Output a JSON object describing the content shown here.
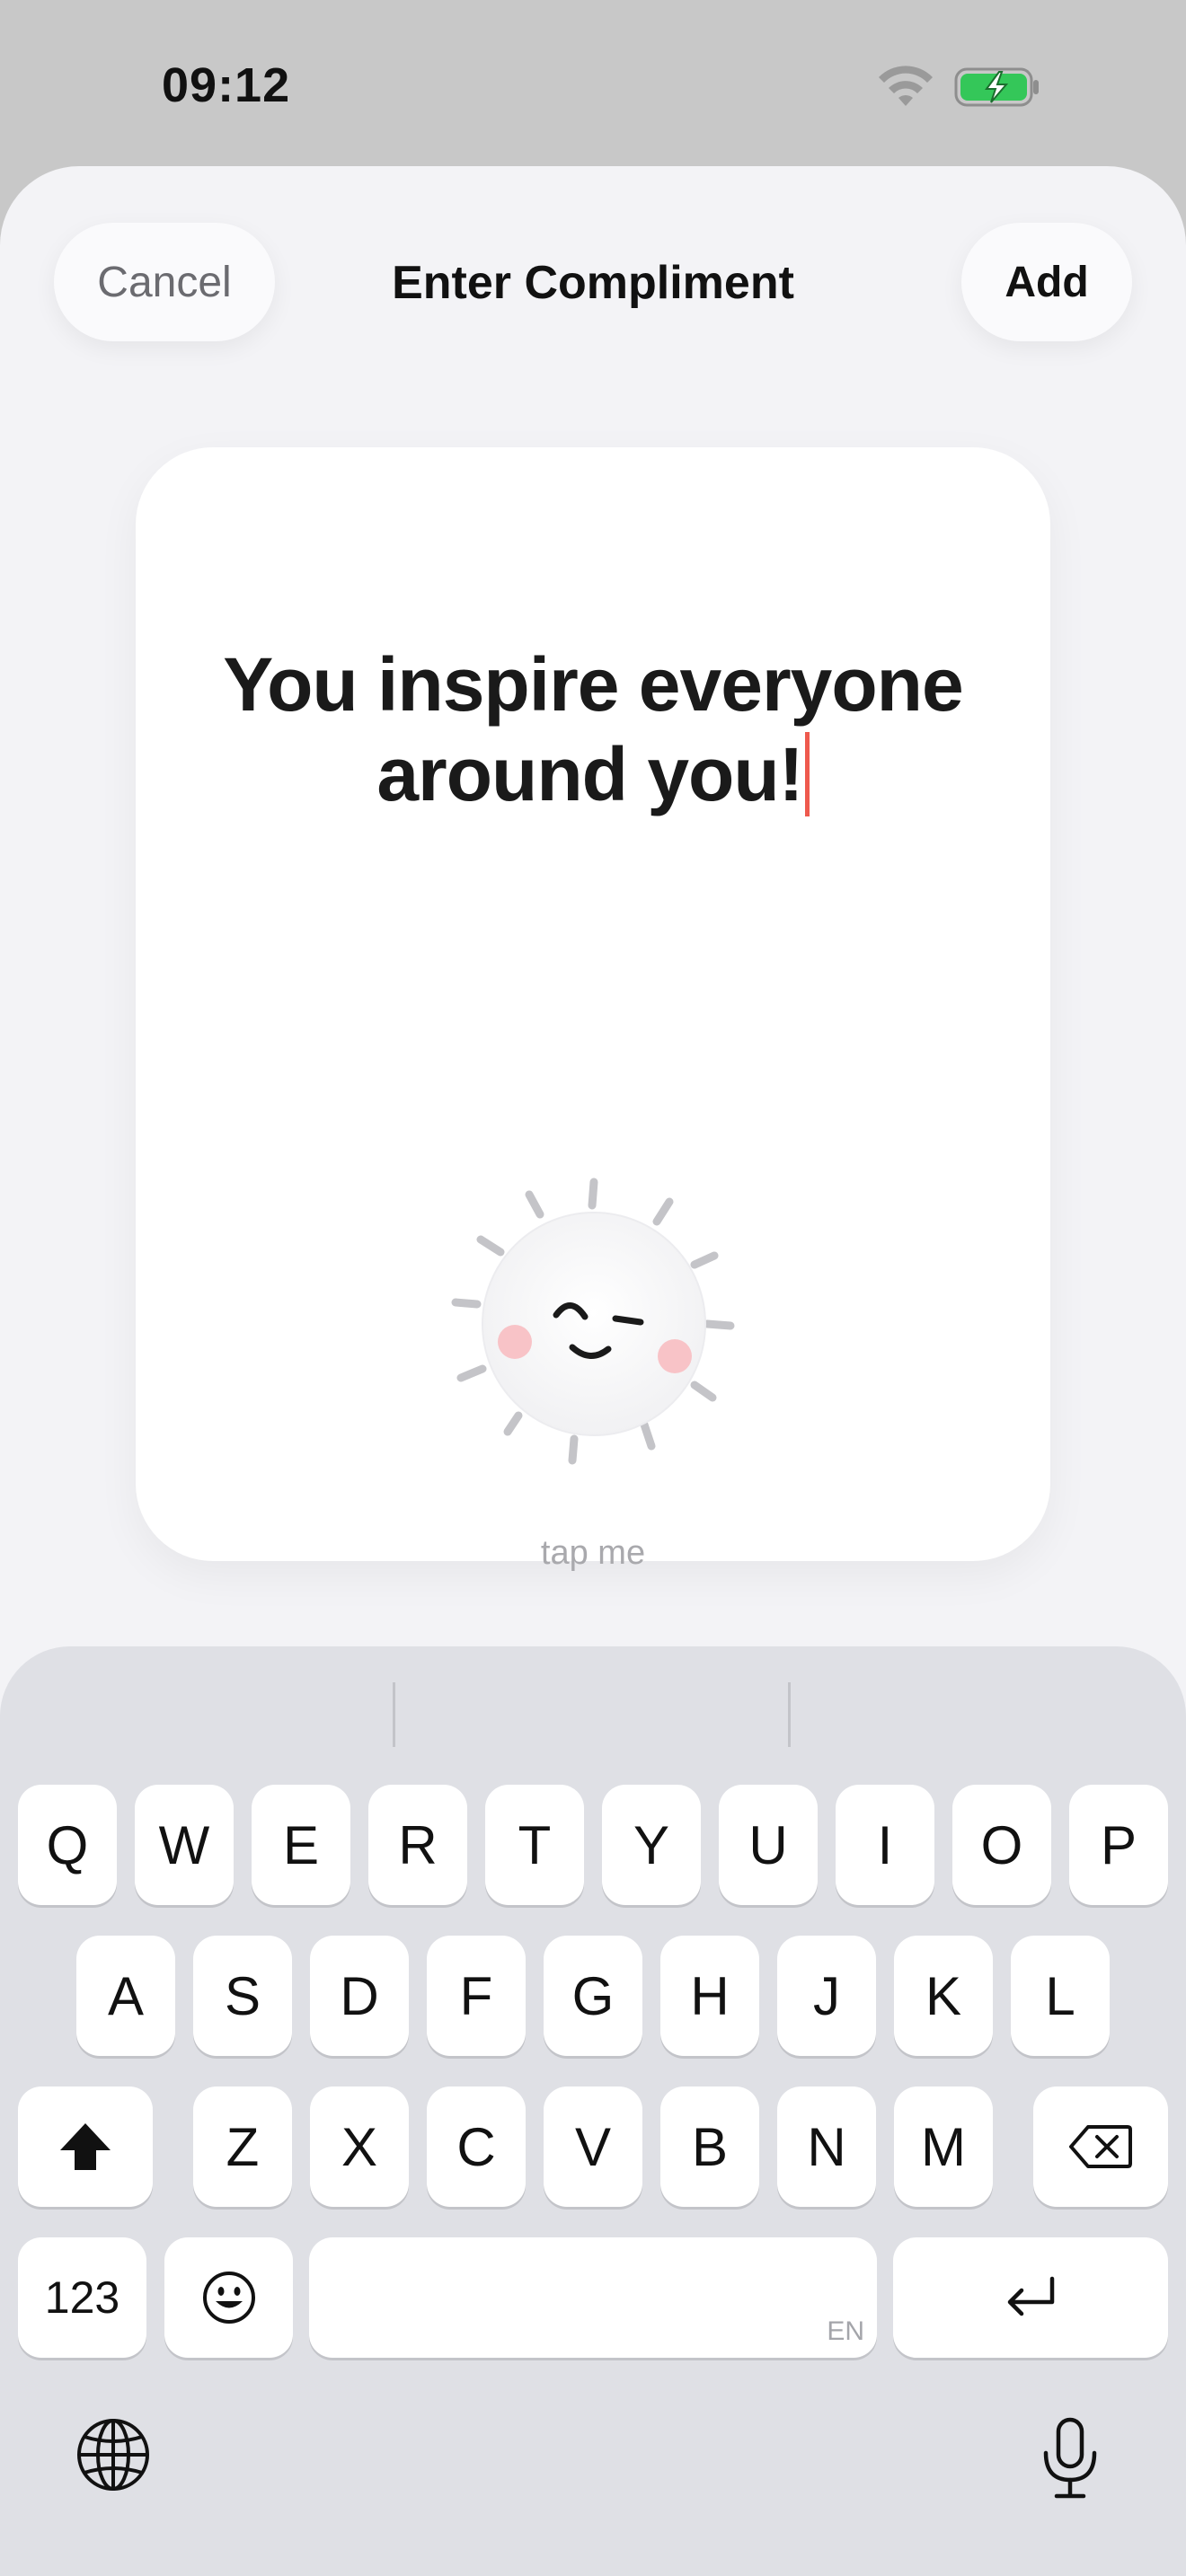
{
  "status_bar": {
    "time": "09:12",
    "icons": [
      "wifi-icon",
      "battery-charging-icon"
    ]
  },
  "sheet": {
    "title": "Enter Compliment",
    "cancel_label": "Cancel",
    "add_label": "Add"
  },
  "card": {
    "line1": "You inspire everyone",
    "line2": "around you!",
    "tap_hint": "tap me",
    "mascot": "smiling-sun-icon"
  },
  "keyboard": {
    "row1": [
      "Q",
      "W",
      "E",
      "R",
      "T",
      "Y",
      "U",
      "I",
      "O",
      "P"
    ],
    "row2": [
      "A",
      "S",
      "D",
      "F",
      "G",
      "H",
      "J",
      "K",
      "L"
    ],
    "row3": [
      "Z",
      "X",
      "C",
      "V",
      "B",
      "N",
      "M"
    ],
    "numbers_label": "123",
    "space_language": "EN",
    "icons": [
      "shift-icon",
      "delete-icon",
      "emoji-icon",
      "return-icon",
      "globe-icon",
      "microphone-icon"
    ]
  },
  "colors": {
    "caret": "#ee5a4e",
    "battery": "#34c759",
    "cheek": "#f8c3c7"
  }
}
